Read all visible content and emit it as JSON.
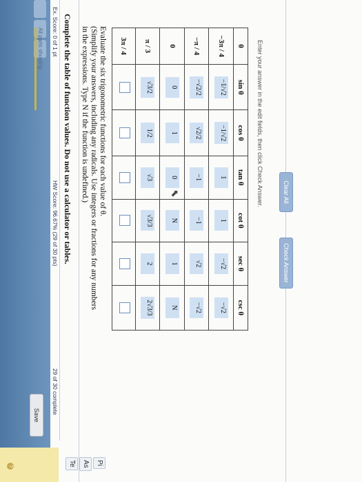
{
  "header": {
    "ex_score": "Ex. Score: 0 of 1 pt",
    "hw_score": "HW Score: 96.67% (29 of 30 pts)",
    "progress": "29 of 30 complete"
  },
  "side_tabs": [
    "Te",
    "As",
    "Pi"
  ],
  "question": {
    "title": "Complete the table of function values. Do not use a calculator or tables.",
    "instruction_1": "Evaluate the six trigonometric functions for each value of θ.",
    "instruction_2": "(Simplify your answers, including any radicals. Use integers or fractions for any numbers in the expressions. Type N if the function is undefined.)"
  },
  "table": {
    "headers": [
      "θ",
      "sin θ",
      "cos θ",
      "tan θ",
      "cot θ",
      "sec θ",
      "csc θ"
    ],
    "rows": [
      {
        "angle": "−3π / 4",
        "cells": [
          "−1/√2",
          "−1/√2",
          "1",
          "1",
          "−√2",
          "−√2"
        ]
      },
      {
        "angle": "−π / 4",
        "cells": [
          "−√2/2",
          "√2/2",
          "−1",
          "−1",
          "√2",
          "−√2"
        ]
      },
      {
        "angle": "0",
        "cells": [
          "0",
          "1",
          "0",
          "N",
          "1",
          "N"
        ]
      },
      {
        "angle": "π / 3",
        "cells": [
          "√3/2",
          "1/2",
          "√3",
          "√3/3",
          "2",
          "2√3/3"
        ]
      },
      {
        "angle": "3π / 4",
        "cells": [
          "",
          "",
          "",
          "",
          "",
          ""
        ]
      }
    ]
  },
  "hint": "Enter your answer in the edit fields, then click Check Answer.",
  "all_parts": "All parts showing",
  "buttons": {
    "clear_all": "Clear All",
    "check_answer": "Check Answer",
    "save": "Save"
  },
  "colors": {
    "answer_fill": "#cfe0f3",
    "blue_bar": "#4d78a4"
  }
}
